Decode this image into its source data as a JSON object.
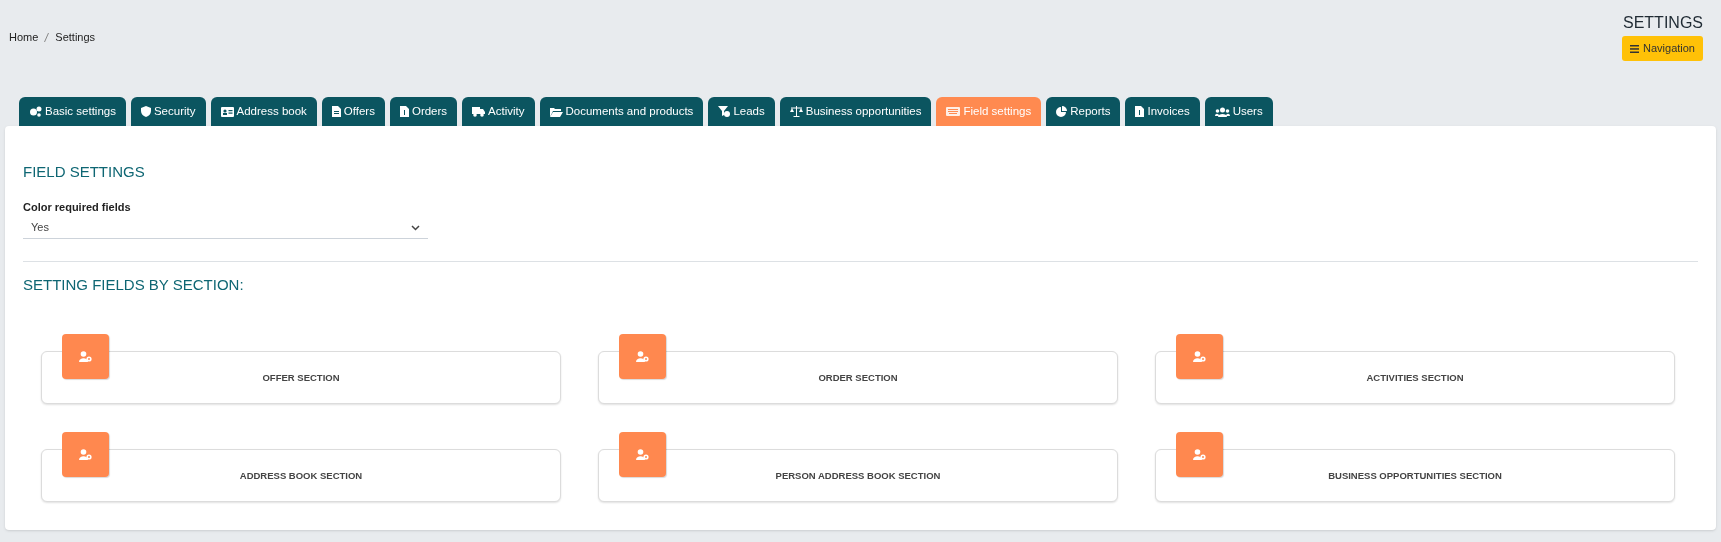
{
  "breadcrumb": [
    "Home",
    "Settings"
  ],
  "page_title": "SETTINGS",
  "navigation_button": "Navigation",
  "tabs": [
    {
      "label": "Basic settings",
      "selected": false
    },
    {
      "label": "Security",
      "selected": false
    },
    {
      "label": "Address book",
      "selected": false
    },
    {
      "label": "Offers",
      "selected": false
    },
    {
      "label": "Orders",
      "selected": false
    },
    {
      "label": "Activity",
      "selected": false
    },
    {
      "label": "Documents and products",
      "selected": false
    },
    {
      "label": "Leads",
      "selected": false
    },
    {
      "label": "Business opportunities",
      "selected": false
    },
    {
      "label": "Field settings",
      "selected": true
    },
    {
      "label": "Reports",
      "selected": false
    },
    {
      "label": "Invoices",
      "selected": false
    },
    {
      "label": "Users",
      "selected": false
    }
  ],
  "panel": {
    "title": "FIELD SETTINGS",
    "color_required_fields": {
      "label": "Color required fields",
      "value": "Yes"
    },
    "sections_heading": "SETTING FIELDS BY SECTION:",
    "sections": [
      {
        "label": "OFFER SECTION"
      },
      {
        "label": "ORDER SECTION"
      },
      {
        "label": "ACTIVITIES SECTION"
      },
      {
        "label": "ADDRESS BOOK SECTION"
      },
      {
        "label": "PERSON ADDRESS BOOK SECTION"
      },
      {
        "label": "BUSINESS OPPORTUNITIES SECTION"
      }
    ]
  }
}
